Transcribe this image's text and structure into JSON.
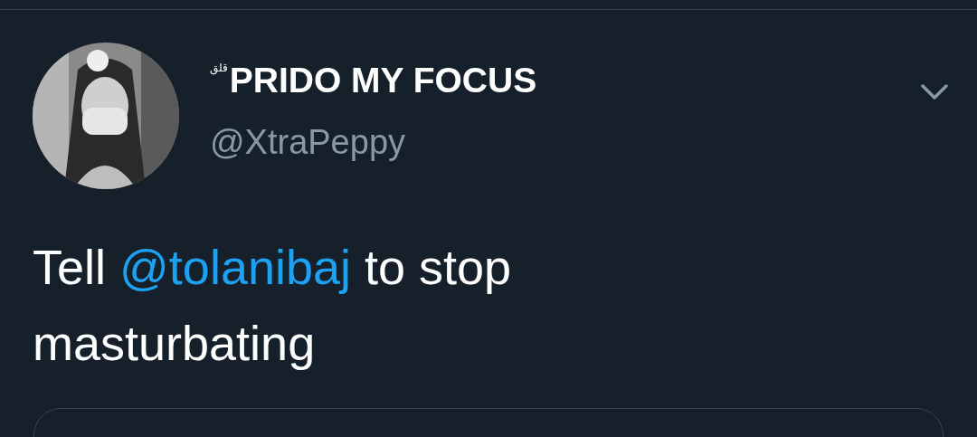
{
  "author": {
    "name_mark": "قلق",
    "name": "PRIDO MY FOCUS",
    "handle": "@XtraPeppy"
  },
  "tweet": {
    "parts": [
      {
        "kind": "text",
        "text": "Tell "
      },
      {
        "kind": "mention",
        "text": "@tolanibaj"
      },
      {
        "kind": "text",
        "text": " to stop masturbating"
      }
    ]
  }
}
